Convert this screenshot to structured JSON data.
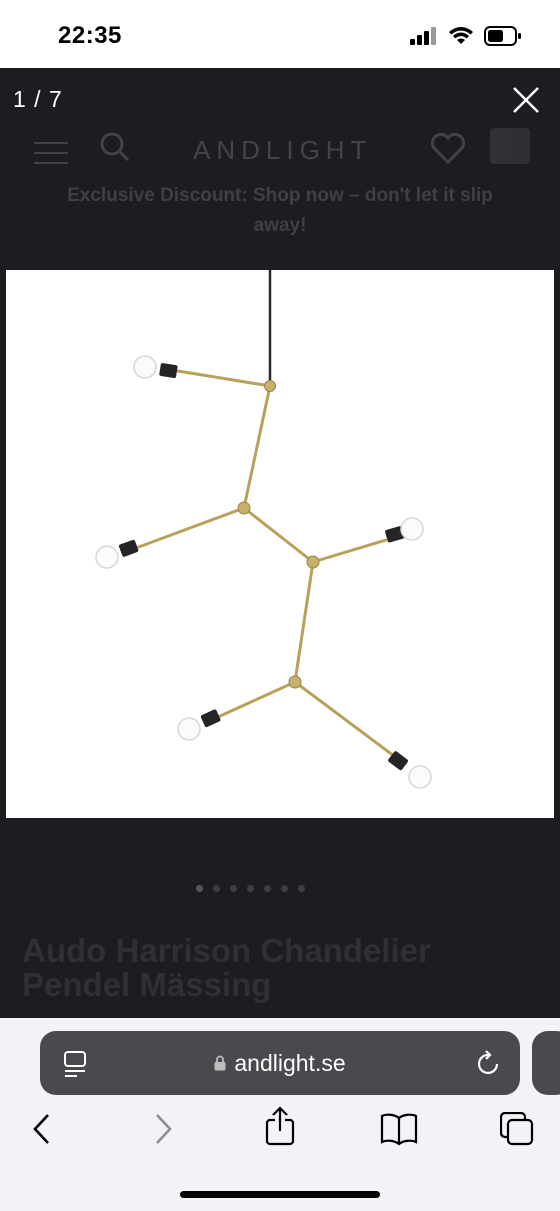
{
  "status_bar": {
    "time": "22:35"
  },
  "page_background": {
    "logo": "ANDLIGHT",
    "banner": "Exclusive Discount: Shop now – don't let it slip away!",
    "product_title": "Audo Harrison Chandelier Pendel Mässing"
  },
  "gallery": {
    "counter": "1 / 7",
    "total_images": 7,
    "current_index": 1
  },
  "browser": {
    "url": "andlight.se"
  }
}
